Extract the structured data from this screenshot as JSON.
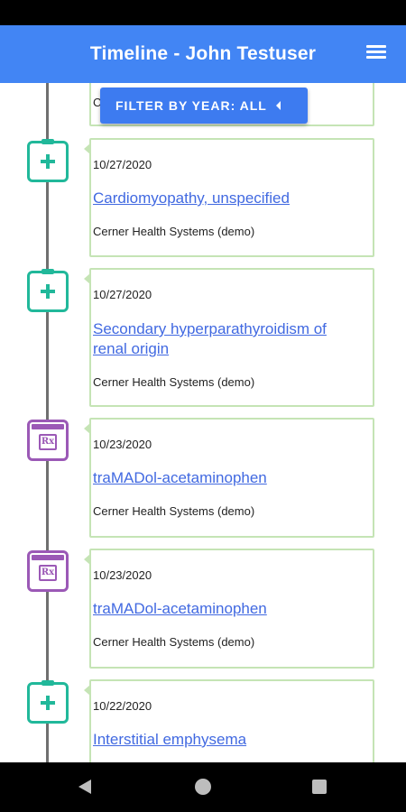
{
  "header": {
    "title": "Timeline - John Testuser",
    "menu_icon": "menu-icon"
  },
  "filter": {
    "label": "FILTER BY YEAR: ALL",
    "caret_icon": "caret-left-icon"
  },
  "colors": {
    "header": "#4285f4",
    "filter_button": "#3d7bf0",
    "condition_icon": "#21b89a",
    "medication_icon": "#9b59b6",
    "card_border": "#c5e4b5",
    "link": "#4169e1"
  },
  "partial_card": {
    "text": "C"
  },
  "events": [
    {
      "type": "condition",
      "icon": "clipboard-plus-icon",
      "date": "10/27/2020",
      "title": "Cardiomyopathy, unspecified",
      "source": "Cerner Health Systems (demo)"
    },
    {
      "type": "condition",
      "icon": "clipboard-plus-icon",
      "date": "10/27/2020",
      "title": "Secondary hyperparathyroidism of renal origin",
      "source": "Cerner Health Systems (demo)"
    },
    {
      "type": "medication",
      "icon": "prescription-bottle-icon",
      "date": "10/23/2020",
      "title": "traMADol-acetaminophen",
      "source": "Cerner Health Systems (demo)"
    },
    {
      "type": "medication",
      "icon": "prescription-bottle-icon",
      "date": "10/23/2020",
      "title": "traMADol-acetaminophen",
      "source": "Cerner Health Systems (demo)"
    },
    {
      "type": "condition",
      "icon": "clipboard-plus-icon",
      "date": "10/22/2020",
      "title": "Interstitial emphysema",
      "source": ""
    }
  ],
  "nav": {
    "back_icon": "back-icon",
    "home_icon": "home-icon",
    "recents_icon": "recents-icon"
  }
}
